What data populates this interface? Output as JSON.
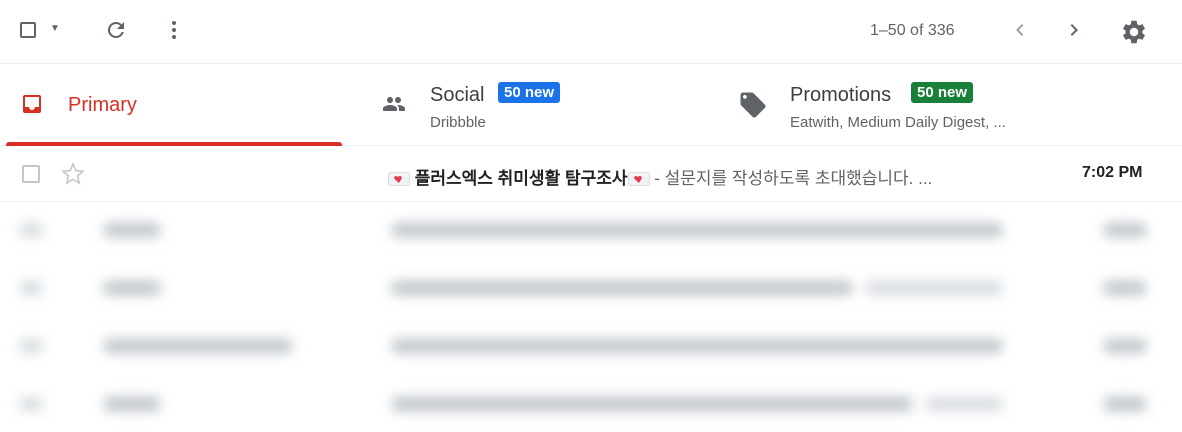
{
  "toolbar": {
    "pagination": "1–50 of 336",
    "icons": {
      "select": "checkbox-icon",
      "select_menu": "caret-down-icon",
      "refresh": "refresh-icon",
      "more": "more-vert-icon",
      "prev": "chevron-left-icon",
      "next": "chevron-right-icon",
      "settings": "gear-icon"
    }
  },
  "tabs": [
    {
      "label": "Primary",
      "icon": "inbox-icon",
      "active": true,
      "color": "#d93025"
    },
    {
      "label": "Social",
      "badge": "50 new",
      "sub": "Dribbble",
      "icon": "people-icon",
      "badge_color": "#1a73e8"
    },
    {
      "label": "Promotions",
      "badge": "50 new",
      "sub": "Eatwith, Medium Daily Digest, ...",
      "icon": "tag-icon",
      "badge_color": "#188038"
    }
  ],
  "emails": [
    {
      "subject": "플러스엑스 취미생활 탐구조사",
      "snippet": " - 설문지를 작성하도록 초대했습니다. ...",
      "time": "7:02 PM",
      "unread": true
    }
  ]
}
